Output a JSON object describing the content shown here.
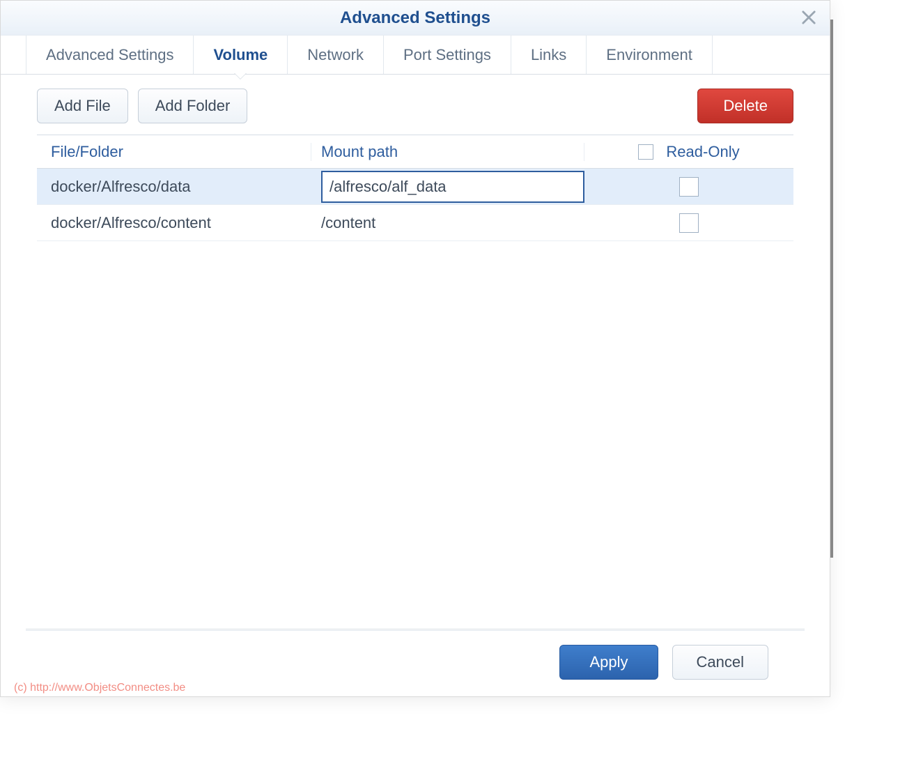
{
  "dialog": {
    "title": "Advanced Settings"
  },
  "tabs": [
    {
      "label": "Advanced Settings",
      "active": false
    },
    {
      "label": "Volume",
      "active": true
    },
    {
      "label": "Network",
      "active": false
    },
    {
      "label": "Port Settings",
      "active": false
    },
    {
      "label": "Links",
      "active": false
    },
    {
      "label": "Environment",
      "active": false
    }
  ],
  "toolbar": {
    "add_file_label": "Add File",
    "add_folder_label": "Add Folder",
    "delete_label": "Delete"
  },
  "table": {
    "headers": {
      "file_folder": "File/Folder",
      "mount_path": "Mount path",
      "read_only": "Read-Only"
    },
    "rows": [
      {
        "file_folder": "docker/Alfresco/data",
        "mount_path": "/alfresco/alf_data",
        "read_only": false,
        "selected": true,
        "editing": true
      },
      {
        "file_folder": "docker/Alfresco/content",
        "mount_path": "/content",
        "read_only": false,
        "selected": false,
        "editing": false
      }
    ]
  },
  "footer": {
    "apply_label": "Apply",
    "cancel_label": "Cancel"
  },
  "watermark": "(c) http://www.ObjetsConnectes.be"
}
